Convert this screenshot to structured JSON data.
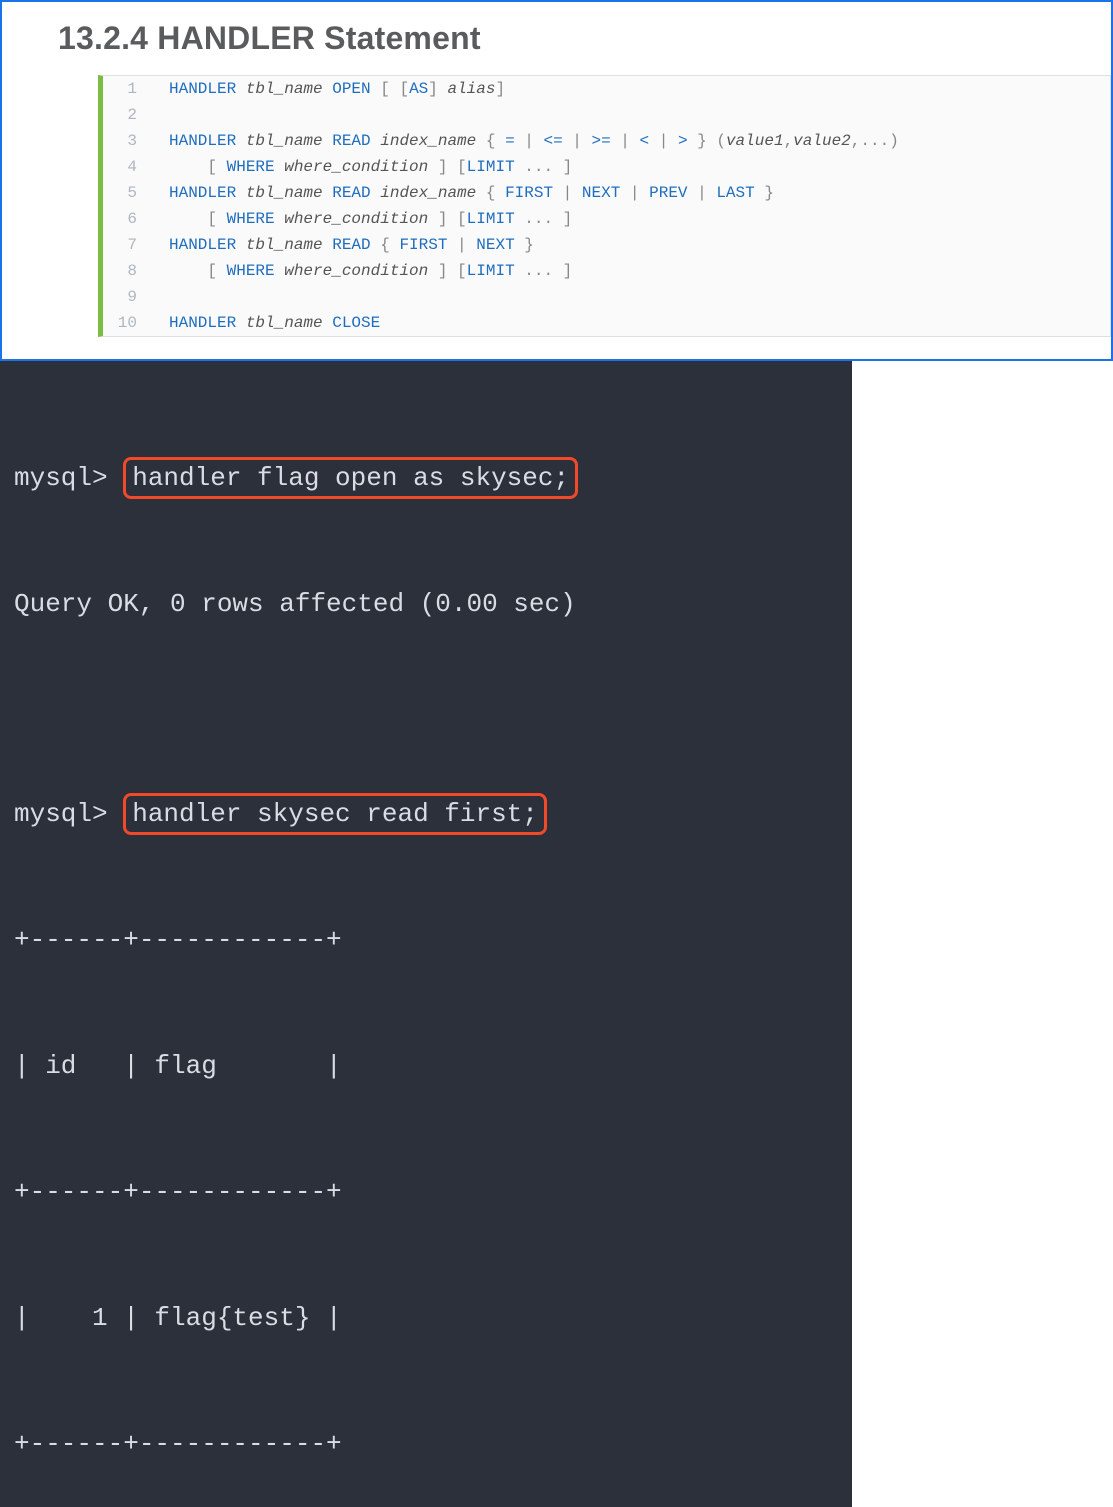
{
  "doc": {
    "title": "13.2.4 HANDLER Statement",
    "lines": [
      {
        "n": "1",
        "segs": [
          [
            "kw",
            "HANDLER "
          ],
          [
            "it",
            "tbl_name"
          ],
          [
            "kw",
            " OPEN "
          ],
          [
            "punct",
            "["
          ],
          [
            "kw",
            " "
          ],
          [
            "punct",
            "["
          ],
          [
            "kw",
            "AS"
          ],
          [
            "punct",
            "]"
          ],
          [
            "it",
            " alias"
          ],
          [
            "punct",
            "]"
          ]
        ]
      },
      {
        "n": "2",
        "segs": []
      },
      {
        "n": "3",
        "segs": [
          [
            "kw",
            "HANDLER "
          ],
          [
            "it",
            "tbl_name"
          ],
          [
            "kw",
            " READ "
          ],
          [
            "it",
            "index_name"
          ],
          [
            "txt",
            " "
          ],
          [
            "punct",
            "{ "
          ],
          [
            "kw",
            "="
          ],
          [
            "punct",
            " | "
          ],
          [
            "kw",
            "<="
          ],
          [
            "punct",
            " | "
          ],
          [
            "kw",
            ">="
          ],
          [
            "punct",
            " | "
          ],
          [
            "kw",
            "<"
          ],
          [
            "punct",
            " | "
          ],
          [
            "kw",
            ">"
          ],
          [
            "punct",
            " } ("
          ],
          [
            "it",
            "value1"
          ],
          [
            "punct",
            ","
          ],
          [
            "it",
            "value2"
          ],
          [
            "punct",
            ",...)"
          ]
        ]
      },
      {
        "n": "4",
        "segs": [
          [
            "txt",
            "    "
          ],
          [
            "punct",
            "[ "
          ],
          [
            "kw",
            "WHERE "
          ],
          [
            "it",
            "where_condition"
          ],
          [
            "punct",
            " ] ["
          ],
          [
            "kw",
            "LIMIT"
          ],
          [
            "punct",
            " ... ]"
          ]
        ]
      },
      {
        "n": "5",
        "segs": [
          [
            "kw",
            "HANDLER "
          ],
          [
            "it",
            "tbl_name"
          ],
          [
            "kw",
            " READ "
          ],
          [
            "it",
            "index_name"
          ],
          [
            "txt",
            " "
          ],
          [
            "punct",
            "{ "
          ],
          [
            "kw",
            "FIRST"
          ],
          [
            "punct",
            " | "
          ],
          [
            "kw",
            "NEXT"
          ],
          [
            "punct",
            " | "
          ],
          [
            "kw",
            "PREV"
          ],
          [
            "punct",
            " | "
          ],
          [
            "kw",
            "LAST"
          ],
          [
            "punct",
            " }"
          ]
        ]
      },
      {
        "n": "6",
        "segs": [
          [
            "txt",
            "    "
          ],
          [
            "punct",
            "[ "
          ],
          [
            "kw",
            "WHERE "
          ],
          [
            "it",
            "where_condition"
          ],
          [
            "punct",
            " ] ["
          ],
          [
            "kw",
            "LIMIT"
          ],
          [
            "punct",
            " ... ]"
          ]
        ]
      },
      {
        "n": "7",
        "segs": [
          [
            "kw",
            "HANDLER "
          ],
          [
            "it",
            "tbl_name"
          ],
          [
            "kw",
            " READ "
          ],
          [
            "punct",
            "{ "
          ],
          [
            "kw",
            "FIRST"
          ],
          [
            "punct",
            " | "
          ],
          [
            "kw",
            "NEXT"
          ],
          [
            "punct",
            " }"
          ]
        ]
      },
      {
        "n": "8",
        "segs": [
          [
            "txt",
            "    "
          ],
          [
            "punct",
            "[ "
          ],
          [
            "kw",
            "WHERE "
          ],
          [
            "it",
            "where_condition"
          ],
          [
            "punct",
            " ] ["
          ],
          [
            "kw",
            "LIMIT"
          ],
          [
            "punct",
            " ... ]"
          ]
        ]
      },
      {
        "n": "9",
        "segs": []
      },
      {
        "n": "10",
        "segs": [
          [
            "kw",
            "HANDLER "
          ],
          [
            "it",
            "tbl_name"
          ],
          [
            "kw",
            " CLOSE"
          ]
        ]
      }
    ]
  },
  "terminal": {
    "prompt1_pre": "mysql> ",
    "cmd1": "handler flag open as skysec;",
    "resp1": "Query OK, 0 rows affected (0.00 sec)",
    "blank": "",
    "prompt2_pre": "mysql> ",
    "cmd2": "handler skysec read first;",
    "row_sep": "+------+------------+",
    "row_head": "| id   | flag       |",
    "row_data": "|    1 | flag{test} |"
  }
}
